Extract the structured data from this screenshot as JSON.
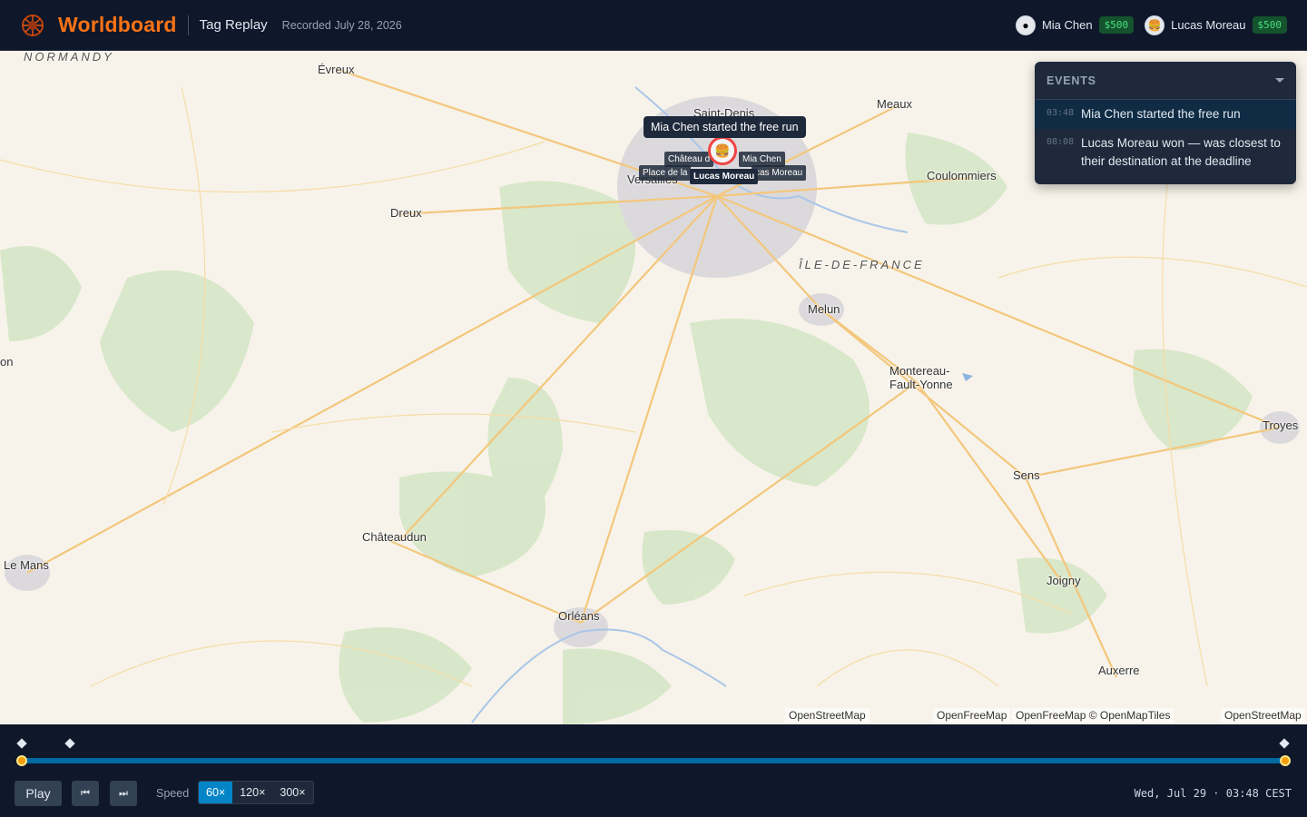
{
  "app": {
    "name": "Worldboard",
    "page": "Tag Replay",
    "recorded": "Recorded July 28, 2026"
  },
  "players": [
    {
      "name": "Mia Chen",
      "money": "$500",
      "avatar": "robot-face-icon"
    },
    {
      "name": "Lucas Moreau",
      "money": "$500",
      "avatar": "burger-icon"
    }
  ],
  "map": {
    "regions": [
      "NORMANDY",
      "ÎLE-DE-FRANCE"
    ],
    "places": [
      "Évreux",
      "Saint-Denis",
      "Meaux",
      "Coulommiers",
      "Versailles",
      "Dreux",
      "Melun",
      "Montereau-",
      "Fault-Yonne",
      "Troyes",
      "Sens",
      "Châteaudun",
      "Le Mans",
      "Orléans",
      "Joigny",
      "Auxerre",
      "on"
    ],
    "tooltip": "Mia Chen started the free run",
    "chips": {
      "chateau": "Château d",
      "mia": "Mia Chen",
      "place": "Place de la",
      "lucas_bold": "Lucas Moreau",
      "lucas_partial": "cas Moreau"
    },
    "attribution": [
      "OpenStreetMap",
      "OpenFreeMap",
      "OpenFreeMap © OpenMapTiles",
      "OpenStreetMap"
    ]
  },
  "events": {
    "title": "EVENTS",
    "items": [
      {
        "time": "03:48",
        "text": "Mia Chen started the free run",
        "active": true
      },
      {
        "time": "08:08",
        "text": "Lucas Moreau won — was closest to their destination at the deadline",
        "active": false
      }
    ]
  },
  "controls": {
    "play": "Play",
    "speed_label": "Speed",
    "speeds": [
      "60×",
      "120×",
      "300×"
    ],
    "selected_speed": "60×",
    "progress": 1.0,
    "clock": "Wed, Jul 29 · 03:48 CEST"
  }
}
